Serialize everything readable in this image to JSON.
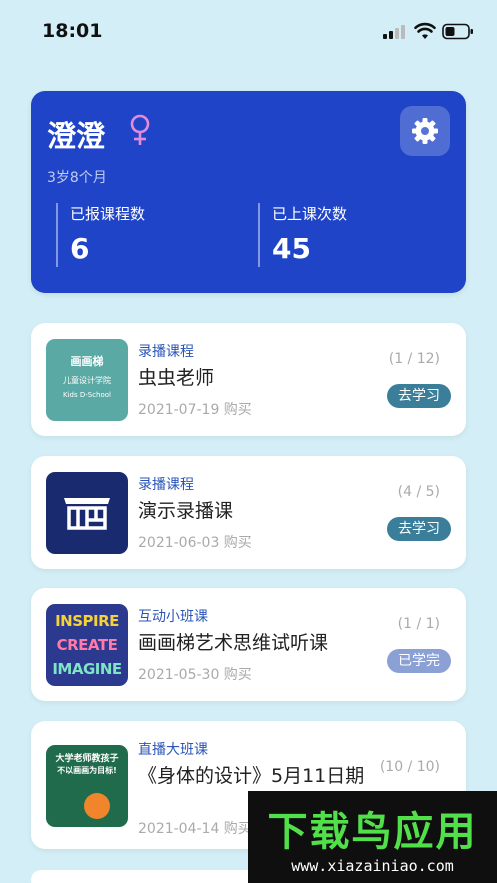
{
  "status_bar": {
    "time": "18:01"
  },
  "profile": {
    "name": "澄澄",
    "gender_symbol": "♀",
    "age": "3岁8个月",
    "enrolled_label": "已报课程数",
    "enrolled_count": "6",
    "attended_label": "已上课次数",
    "attended_count": "45"
  },
  "courses": [
    {
      "type": "录播课程",
      "title": "虫虫老师",
      "date": "2021-07-19 购买",
      "progress": "(1 / 12)",
      "button": "去学习",
      "thumb": {
        "line1": "画画梯",
        "line2": "儿童设计学院",
        "line3": "Kids D-School"
      }
    },
    {
      "type": "录播课程",
      "title": "演示录播课",
      "date": "2021-06-03 购买",
      "progress": "(4 / 5)",
      "button": "去学习"
    },
    {
      "type": "互动小班课",
      "title": "画画梯艺术思维试听课",
      "date": "2021-05-30 购买",
      "progress": "(1 / 1)",
      "button": "已学完",
      "thumb": {
        "line1": "INSPIRE",
        "line2": "CREATE",
        "line3": "IMAGINE"
      }
    },
    {
      "type": "直播大班课",
      "title": "《身体的设计》5月11日期",
      "date": "2021-04-14 购买",
      "progress": "(10 / 10)",
      "thumb": {
        "line1": "大学老师教孩子",
        "line2": "不以画画为目标!"
      }
    }
  ],
  "watermark": {
    "title": "下载鸟应用",
    "url": "www.xiazainiao.com"
  },
  "colors": {
    "card_blue": "#1f44c8",
    "study_button": "#3b7e99",
    "done_button": "#8ba1d6",
    "type_text": "#2a55b8"
  }
}
